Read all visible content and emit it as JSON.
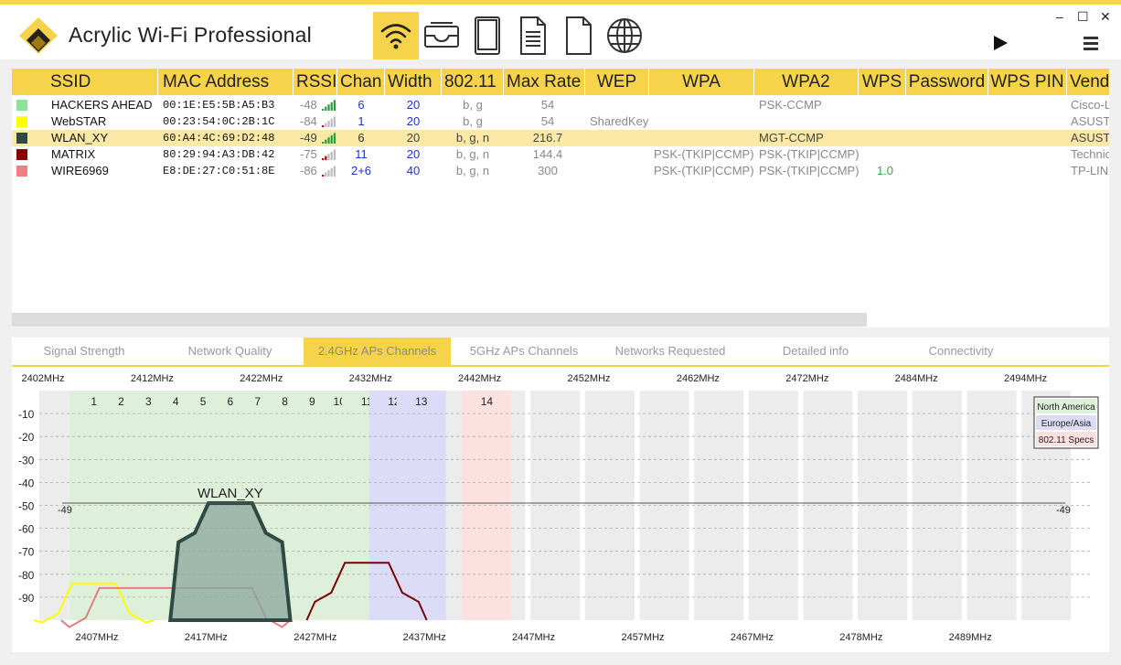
{
  "app": {
    "title": "Acrylic Wi-Fi Professional",
    "accent": "#f7d34b",
    "toolbar_icons": [
      "wifi-icon",
      "inbox-icon",
      "tablet-icon",
      "document-icon",
      "blank-document-icon",
      "globe-icon"
    ],
    "window_controls": {
      "minimize": "–",
      "maximize": "☐",
      "close": "✕"
    }
  },
  "table": {
    "headers": [
      "SSID",
      "MAC Address",
      "RSSI",
      "Chan",
      "Width",
      "802.11",
      "Max Rate",
      "WEP",
      "WPA",
      "WPA2",
      "WPS",
      "Password",
      "WPS PIN",
      "Vend"
    ],
    "rows": [
      {
        "color": "#8ee39a",
        "ssid": "HACKERS AHEAD",
        "mac": "00:1E:E5:5B:A5:B3",
        "rssi": "-48",
        "chan": "6",
        "width": "20",
        "std": "b, g",
        "rate": "54",
        "wep": "",
        "wpa": "",
        "wpa2": "PSK-CCMP",
        "wps": "",
        "vendor": "Cisco-L"
      },
      {
        "color": "#ffff00",
        "ssid": "WebSTAR",
        "mac": "00:23:54:0C:2B:1C",
        "rssi": "-84",
        "chan": "1",
        "width": "20",
        "std": "b, g",
        "rate": "54",
        "wep": "SharedKey",
        "wpa": "",
        "wpa2": "",
        "wps": "",
        "vendor": "ASUSTe"
      },
      {
        "color": "#2f4a45",
        "ssid": "WLAN_XY",
        "mac": "60:A4:4C:69:D2:48",
        "rssi": "-49",
        "chan": "6",
        "width": "20",
        "std": "b, g, n",
        "rate": "216.7",
        "wep": "",
        "wpa": "",
        "wpa2": "MGT-CCMP",
        "wps": "",
        "vendor": "ASUSTe"
      },
      {
        "color": "#8b0000",
        "ssid": "MATRIX",
        "mac": "80:29:94:A3:DB:42",
        "rssi": "-75",
        "chan": "11",
        "width": "20",
        "std": "b, g, n",
        "rate": "144.4",
        "wep": "",
        "wpa": "PSK-(TKIP|CCMP)",
        "wpa2": "PSK-(TKIP|CCMP)",
        "wps": "",
        "vendor": "Technic"
      },
      {
        "color": "#f08080",
        "ssid": "WIRE6969",
        "mac": "E8:DE:27:C0:51:8E",
        "rssi": "-86",
        "chan": "2+6",
        "width": "40",
        "std": "b, g, n",
        "rate": "300",
        "wep": "",
        "wpa": "PSK-(TKIP|CCMP)",
        "wpa2": "PSK-(TKIP|CCMP)",
        "wps": "1.0",
        "vendor": "TP-LIN"
      }
    ]
  },
  "tabs": [
    "Signal Strength",
    "Network Quality",
    "2.4GHz APs Channels",
    "5GHz APs Channels",
    "Networks Requested",
    "Detailed info",
    "Connectivity"
  ],
  "active_tab": "2.4GHz APs Channels",
  "chart_data": {
    "type": "line",
    "top_freq_labels": [
      "2402MHz",
      "2412MHz",
      "2422MHz",
      "2432MHz",
      "2442MHz",
      "2452MHz",
      "2462MHz",
      "2472MHz",
      "2484MHz",
      "2494MHz"
    ],
    "bottom_freq_labels": [
      "2407MHz",
      "2417MHz",
      "2427MHz",
      "2437MHz",
      "2447MHz",
      "2457MHz",
      "2467MHz",
      "2478MHz",
      "2489MHz"
    ],
    "channels": [
      "1",
      "2",
      "3",
      "4",
      "5",
      "6",
      "7",
      "8",
      "9",
      "10",
      "11",
      "12",
      "13",
      "14"
    ],
    "y_ticks": [
      "-10",
      "-20",
      "-30",
      "-40",
      "-50",
      "-60",
      "-70",
      "-80",
      "-90"
    ],
    "ylim": [
      -100,
      0
    ],
    "legend": [
      "North America",
      "Europe/Asia",
      "802.11 Specs"
    ],
    "legend_colors": [
      "#dff0da",
      "#dcdcf8",
      "#fde0e0"
    ],
    "highlight_ssid": "WLAN_XY",
    "highlight_rssi": "-49",
    "series": [
      {
        "name": "WLAN_XY",
        "color": "#2f4a45",
        "fill": "#8aa79c",
        "center_channel": 6,
        "width_mhz": 20,
        "rssi": -49
      },
      {
        "name": "WebSTAR",
        "color": "#ffff00",
        "center_channel": 1,
        "width_mhz": 20,
        "rssi": -84
      },
      {
        "name": "WIRE6969",
        "color": "#e08080",
        "center_channel": 4,
        "width_mhz": 40,
        "rssi": -86
      },
      {
        "name": "MATRIX",
        "color": "#7a0000",
        "center_channel": 11,
        "width_mhz": 20,
        "rssi": -75
      }
    ]
  }
}
